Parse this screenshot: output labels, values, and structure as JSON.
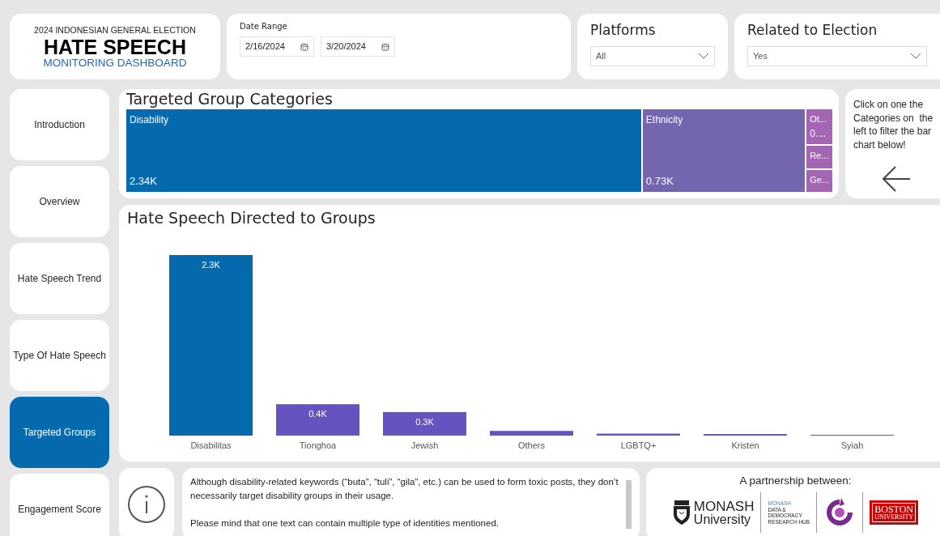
{
  "header": {
    "subtitle": "2024 INDONESIAN GENERAL ELECTION",
    "title": "HATE SPEECH",
    "tagline": "MONITORING DASHBOARD"
  },
  "date_range": {
    "label": "Date Range",
    "start": "2/16/2024",
    "end": "3/20/2024"
  },
  "filters": [
    {
      "label": "Platforms",
      "value": "All"
    },
    {
      "label": "Related to Election",
      "value": "Yes"
    }
  ],
  "sidebar": {
    "items": [
      {
        "label": "Introduction",
        "selected": false
      },
      {
        "label": "Overview",
        "selected": false
      },
      {
        "label": "Hate Speech Trend",
        "selected": false
      },
      {
        "label": "Type Of Hate Speech",
        "selected": false
      },
      {
        "label": "Targeted Groups",
        "selected": true
      },
      {
        "label": "Engagement Score",
        "selected": false
      }
    ]
  },
  "treemap": {
    "title": "Targeted Group Categories",
    "tiles": [
      {
        "label": "Disability",
        "value": "2.34K",
        "color": "#0569ad"
      },
      {
        "label": "Ethnicity",
        "value": "0.73K",
        "color": "#7466ae"
      }
    ],
    "small_tiles": [
      {
        "label": "Ot...",
        "value": "0....",
        "color": "#a366b3"
      },
      {
        "label": "Re...",
        "color": "#a366b3"
      },
      {
        "label": "Ge...",
        "color": "#a366b3"
      }
    ]
  },
  "hint": {
    "text": "Click on one the Categories on  the left to filter the bar chart below!"
  },
  "bar_panel": {
    "title": "Hate Speech Directed to Groups",
    "chart_data": {
      "type": "bar",
      "categories": [
        "Disabilitas",
        "Tionghoa",
        "Jewish",
        "Others",
        "LGBTQ+",
        "Kristen",
        "Syiah"
      ],
      "stacked": true,
      "series": [
        {
          "color": "#0569ad",
          "values": [
            2300,
            null,
            null,
            null,
            null,
            null,
            null
          ],
          "value_labels": [
            "2.3K",
            null,
            null,
            null,
            null,
            null,
            null
          ]
        },
        {
          "color": "#6753bf",
          "values": [
            null,
            400,
            300,
            60,
            25,
            20,
            5
          ],
          "value_labels": [
            null,
            "0.4K",
            "0.3K",
            null,
            null,
            null,
            null
          ]
        }
      ]
    }
  },
  "info": {
    "paragraphs": [
      "Although disability-related keywords (“buta”, “tuli”, “gila”, etc.) can be used to form toxic posts, they don’t necessarily target disability groups in their usage.",
      "Please mind that one text can contain multiple type of identities mentioned."
    ]
  },
  "partners": {
    "title": "A partnership between:",
    "monash": [
      "MONASH",
      "University"
    ],
    "hub": [
      "MONASH",
      "DATA &",
      "DEMOCRACY",
      "RESEARCH HUB"
    ],
    "boston": [
      "BOSTON",
      "UNIVERSITY"
    ]
  }
}
